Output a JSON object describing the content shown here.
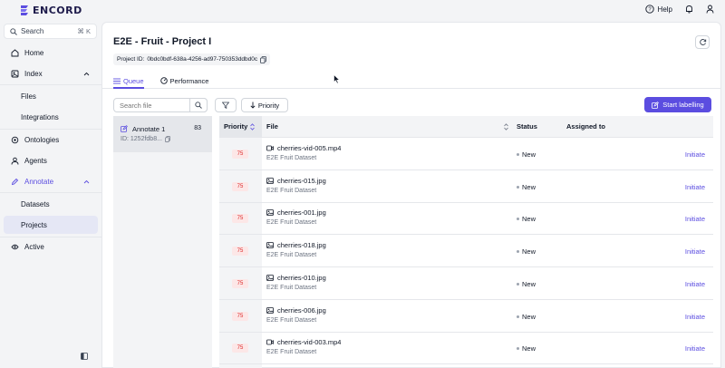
{
  "brand": {
    "name": "ENCORD",
    "accent": "#5b4de0"
  },
  "topbar": {
    "help_label": "Help"
  },
  "sidebar": {
    "search_label": "Search",
    "search_shortcut": "⌘ K",
    "items": [
      {
        "label": "Home"
      },
      {
        "label": "Index"
      },
      {
        "label": "Files"
      },
      {
        "label": "Integrations"
      },
      {
        "label": "Ontologies"
      },
      {
        "label": "Agents"
      },
      {
        "label": "Annotate"
      },
      {
        "label": "Datasets"
      },
      {
        "label": "Projects"
      },
      {
        "label": "Active"
      }
    ]
  },
  "project": {
    "title": "E2E - Fruit - Project I",
    "id_label": "Project ID:",
    "id_value": "0bdc0bdf-638a-4256-ad97-750353ddbd0c"
  },
  "tabs": [
    {
      "label": "Queue",
      "active": true
    },
    {
      "label": "Performance",
      "active": false
    }
  ],
  "toolbar": {
    "search_placeholder": "Search file",
    "priority_label": "Priority",
    "start_label": "Start labelling"
  },
  "task": {
    "name": "Annotate 1",
    "count": "83",
    "id": "ID: 1252fdb8..."
  },
  "table": {
    "headers": {
      "priority": "Priority",
      "file": "File",
      "status": "Status",
      "assigned": "Assigned to"
    },
    "action_label": "Initiate",
    "rows": [
      {
        "priority": "75",
        "file": "cherries-vid-005.mp4",
        "type": "video",
        "dataset": "E2E Fruit Dataset",
        "status": "New"
      },
      {
        "priority": "75",
        "file": "cherries-015.jpg",
        "type": "image",
        "dataset": "E2E Fruit Dataset",
        "status": "New"
      },
      {
        "priority": "75",
        "file": "cherries-001.jpg",
        "type": "image",
        "dataset": "E2E Fruit Dataset",
        "status": "New"
      },
      {
        "priority": "75",
        "file": "cherries-018.jpg",
        "type": "image",
        "dataset": "E2E Fruit Dataset",
        "status": "New"
      },
      {
        "priority": "75",
        "file": "cherries-010.jpg",
        "type": "image",
        "dataset": "E2E Fruit Dataset",
        "status": "New"
      },
      {
        "priority": "75",
        "file": "cherries-006.jpg",
        "type": "image",
        "dataset": "E2E Fruit Dataset",
        "status": "New"
      },
      {
        "priority": "75",
        "file": "cherries-vid-003.mp4",
        "type": "video",
        "dataset": "E2E Fruit Dataset",
        "status": "New"
      }
    ]
  }
}
